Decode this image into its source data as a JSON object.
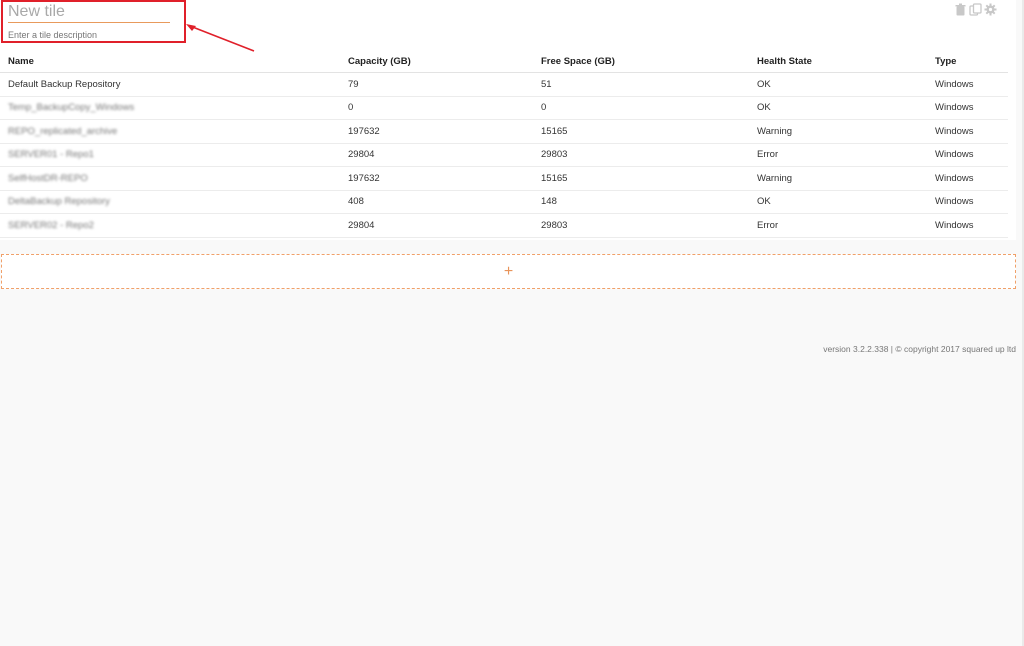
{
  "tile": {
    "title_placeholder": "New tile",
    "description_placeholder": "Enter a tile description"
  },
  "actions": [
    {
      "name": "delete-icon"
    },
    {
      "name": "copy-icon"
    },
    {
      "name": "gear-icon"
    }
  ],
  "table": {
    "headers": [
      "Name",
      "Capacity (GB)",
      "Free Space (GB)",
      "Health State",
      "Type"
    ],
    "rows": [
      {
        "name": "Default Backup Repository",
        "capacity": "79",
        "free": "51",
        "health": "OK",
        "type": "Windows"
      },
      {
        "name": "Temp_BackupCopy_Windows",
        "capacity": "0",
        "free": "0",
        "health": "OK",
        "type": "Windows"
      },
      {
        "name": "REPO_replicated_archive",
        "capacity": "197632",
        "free": "15165",
        "health": "Warning",
        "type": "Windows"
      },
      {
        "name": "SERVER01 - Repo1",
        "capacity": "29804",
        "free": "29803",
        "health": "Error",
        "type": "Windows"
      },
      {
        "name": "SelfHostDR-REPO",
        "capacity": "197632",
        "free": "15165",
        "health": "Warning",
        "type": "Windows"
      },
      {
        "name": "DeltaBackup Repository",
        "capacity": "408",
        "free": "148",
        "health": "OK",
        "type": "Windows"
      },
      {
        "name": "SERVER02 - Repo2",
        "capacity": "29804",
        "free": "29803",
        "health": "Error",
        "type": "Windows"
      }
    ]
  },
  "add_tile": {
    "label": "+"
  },
  "footer": {
    "text": "version 3.2.2.338  | © copyright 2017 squared up ltd"
  },
  "colors": {
    "accent": "#e8945a",
    "highlight": "#e0202a"
  }
}
